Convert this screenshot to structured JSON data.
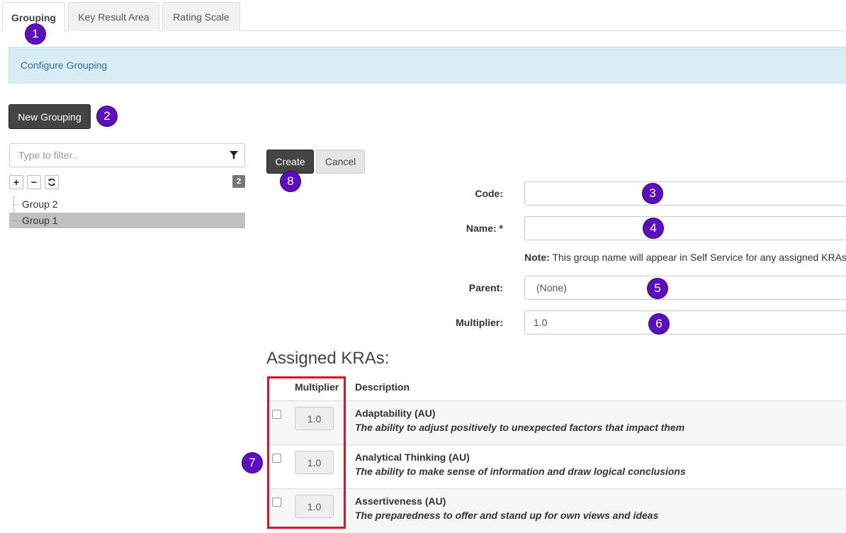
{
  "tabs": [
    {
      "label": "Grouping",
      "active": true
    },
    {
      "label": "Key Result Area",
      "active": false
    },
    {
      "label": "Rating Scale",
      "active": false
    }
  ],
  "banner": {
    "text": "Configure Grouping"
  },
  "toolbar": {
    "new_grouping_label": "New Grouping"
  },
  "filter": {
    "placeholder": "Type to filter..",
    "icon": "filter-icon"
  },
  "tree": {
    "controls": {
      "expand": "+",
      "collapse": "−",
      "refresh_icon": "refresh-icon"
    },
    "count": "2",
    "items": [
      {
        "label": "Group 2",
        "selected": false
      },
      {
        "label": "Group 1",
        "selected": true
      }
    ]
  },
  "form": {
    "create_label": "Create",
    "cancel_label": "Cancel",
    "code": {
      "label": "Code:",
      "value": ""
    },
    "name": {
      "label": "Name: *",
      "value": ""
    },
    "note": {
      "bold": "Note:",
      "text": " This group name will appear in Self Service for any assigned KRAs"
    },
    "parent": {
      "label": "Parent:",
      "value": "(None)"
    },
    "multiplier": {
      "label": "Multiplier:",
      "value": "1.0"
    }
  },
  "assigned": {
    "title": "Assigned KRAs:",
    "headers": {
      "multiplier": "Multiplier",
      "description": "Description"
    },
    "rows": [
      {
        "name": "Adaptability (AU)",
        "desc": "The ability to adjust positively to unexpected factors that impact them",
        "multiplier": "1.0",
        "checked": false
      },
      {
        "name": "Analytical Thinking (AU)",
        "desc": "The ability to make sense of information and draw logical conclusions",
        "multiplier": "1.0",
        "checked": false
      },
      {
        "name": "Assertiveness (AU)",
        "desc": "The preparedness to offer and stand up for own views and ideas",
        "multiplier": "1.0",
        "checked": false
      }
    ]
  },
  "callouts": [
    "1",
    "2",
    "3",
    "4",
    "5",
    "6",
    "7",
    "8"
  ],
  "colors": {
    "callout": "#5b0fbe",
    "highlight_box": "#e0141e",
    "banner_bg": "#d9edf7"
  }
}
